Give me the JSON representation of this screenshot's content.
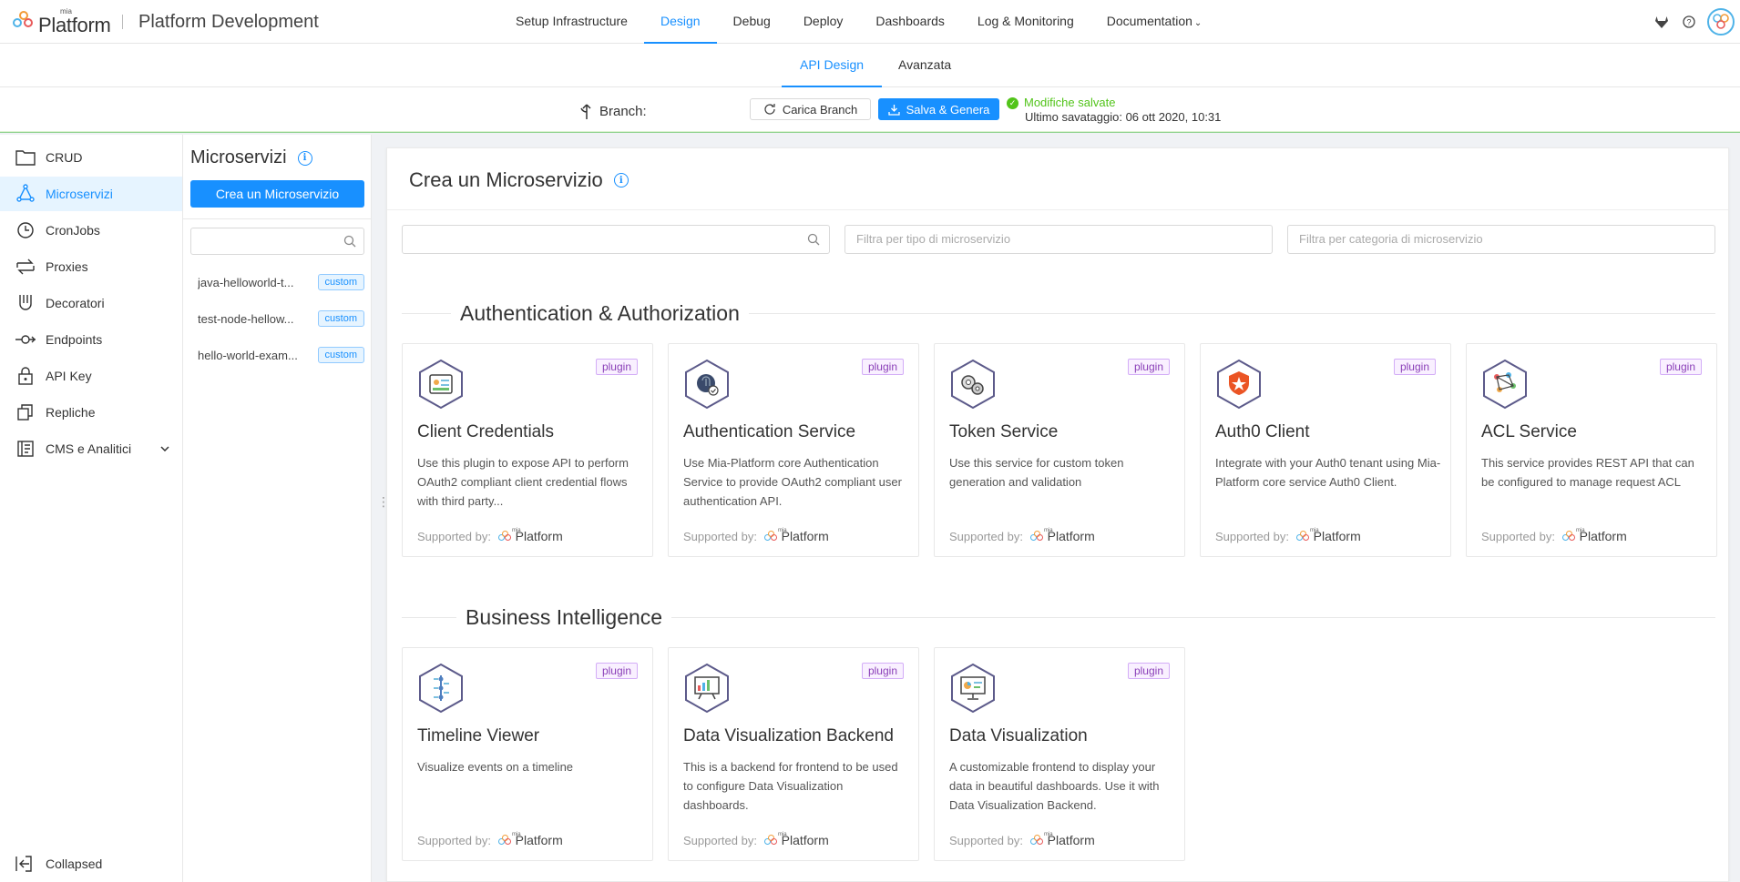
{
  "app": {
    "logo_small": "mia",
    "logo_big": "Platform",
    "title": "Platform Development"
  },
  "topnav": [
    {
      "label": "Setup Infrastructure"
    },
    {
      "label": "Design"
    },
    {
      "label": "Debug"
    },
    {
      "label": "Deploy"
    },
    {
      "label": "Dashboards"
    },
    {
      "label": "Log & Monitoring"
    },
    {
      "label": "Documentation"
    }
  ],
  "subtabs": [
    {
      "label": "API Design"
    },
    {
      "label": "Avanzata"
    }
  ],
  "branchbar": {
    "branch_label": "Branch:",
    "reload_label": "Carica Branch",
    "save_label": "Salva & Genera",
    "status": "Modifiche salvate",
    "last_save_label": "Ultimo savataggio:",
    "last_save_value": "06 ott 2020, 10:31"
  },
  "sidebar": {
    "items": [
      {
        "label": "CRUD",
        "icon": "folder-icon"
      },
      {
        "label": "Microservizi",
        "icon": "microservices-icon"
      },
      {
        "label": "CronJobs",
        "icon": "clock-icon"
      },
      {
        "label": "Proxies",
        "icon": "swap-icon"
      },
      {
        "label": "Decoratori",
        "icon": "decorator-icon"
      },
      {
        "label": "Endpoints",
        "icon": "endpoint-icon"
      },
      {
        "label": "API Key",
        "icon": "lock-icon"
      },
      {
        "label": "Repliche",
        "icon": "copy-icon"
      },
      {
        "label": "CMS e Analitici",
        "icon": "cms-icon"
      }
    ],
    "collapsed_label": "Collapsed"
  },
  "microservices_panel": {
    "title": "Microservizi",
    "create_label": "Crea un Microservizio",
    "search_placeholder": "",
    "items": [
      {
        "name": "java-helloworld-t...",
        "tag": "custom"
      },
      {
        "name": "test-node-hellow...",
        "tag": "custom"
      },
      {
        "name": "hello-world-exam...",
        "tag": "custom"
      }
    ]
  },
  "main": {
    "title": "Crea un Microservizio",
    "search_placeholder": "",
    "filter_type_placeholder": "Filtra per tipo di microservizio",
    "filter_category_placeholder": "Filtra per categoria di microservizio",
    "sections": [
      {
        "title": "Authentication & Authorization",
        "cards": [
          {
            "title": "Client Credentials",
            "badge": "plugin",
            "description": "Use this plugin to expose API to perform OAuth2 compliant client credential flows with third party...",
            "supported_by": "Supported by:",
            "supporter_small": "mia",
            "supporter": "Platform",
            "icon": "id-card-icon"
          },
          {
            "title": "Authentication Service",
            "badge": "plugin",
            "description": "Use Mia-Platform core Authentication Service to provide OAuth2 compliant user authentication API.",
            "supported_by": "Supported by:",
            "supporter_small": "mia",
            "supporter": "Platform",
            "icon": "fingerprint-icon"
          },
          {
            "title": "Token Service",
            "badge": "plugin",
            "description": "Use this service for custom token generation and validation",
            "supported_by": "Supported by:",
            "supporter_small": "mia",
            "supporter": "Platform",
            "icon": "gears-icon"
          },
          {
            "title": "Auth0 Client",
            "badge": "plugin",
            "description": "Integrate with your Auth0 tenant using Mia-Platform core service Auth0 Client.",
            "supported_by": "Supported by:",
            "supporter_small": "mia",
            "supporter": "Platform",
            "icon": "auth0-icon"
          },
          {
            "title": "ACL Service",
            "badge": "plugin",
            "description": "This service provides REST API that can be configured to manage request ACL",
            "supported_by": "Supported by:",
            "supporter_small": "mia",
            "supporter": "Platform",
            "icon": "network-icon"
          }
        ]
      },
      {
        "title": "Business Intelligence",
        "cards": [
          {
            "title": "Timeline Viewer",
            "badge": "plugin",
            "description": "Visualize events on a timeline",
            "supported_by": "Supported by:",
            "supporter_small": "mia",
            "supporter": "Platform",
            "icon": "timeline-icon"
          },
          {
            "title": "Data Visualization Backend",
            "badge": "plugin",
            "description": "This is a backend for frontend to be used to configure Data Visualization dashboards.",
            "supported_by": "Supported by:",
            "supporter_small": "mia",
            "supporter": "Platform",
            "icon": "chart-board-icon"
          },
          {
            "title": "Data Visualization",
            "badge": "plugin",
            "description": "A customizable frontend to display your data in beautiful dashboards. Use it with Data Visualization Backend.",
            "supported_by": "Supported by:",
            "supporter_small": "mia",
            "supporter": "Platform",
            "icon": "dashboard-icon"
          }
        ]
      }
    ]
  },
  "colors": {
    "accent": "#1890ff",
    "success": "#52c41a",
    "plugin_badge": "#8a3fb8",
    "active_bg": "#e6f4ff"
  }
}
